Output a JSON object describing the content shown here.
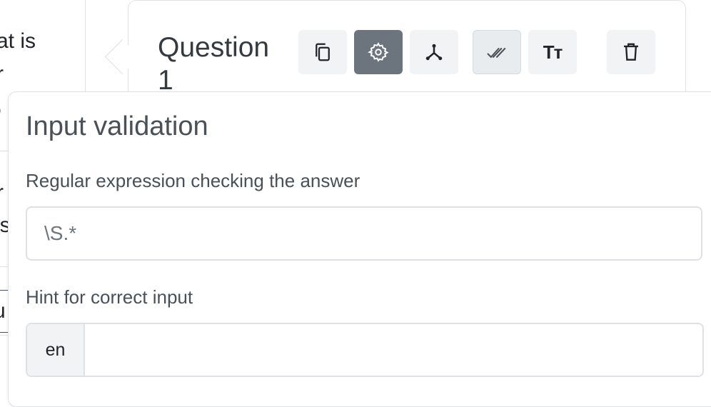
{
  "sidebar": {
    "fragments": [
      "at is",
      "r",
      "o",
      "r",
      "es",
      "u"
    ]
  },
  "question": {
    "title": "Question 1",
    "toolbar": {
      "duplicate_icon": "copy-icon",
      "settings_icon": "gear-icon",
      "branching_icon": "fork-icon",
      "validation_icon": "double-check-icon",
      "text_format_label": "Tт",
      "delete_icon": "trash-icon"
    },
    "colors": {
      "active_button": "#6c757d",
      "button_bg": "#f1f3f5"
    }
  },
  "validation_popover": {
    "title": "Input validation",
    "regex_label": "Regular expression checking the answer",
    "regex_value": "\\S.*",
    "hint_label": "Hint for correct input",
    "hint_language": "en",
    "hint_value": ""
  }
}
